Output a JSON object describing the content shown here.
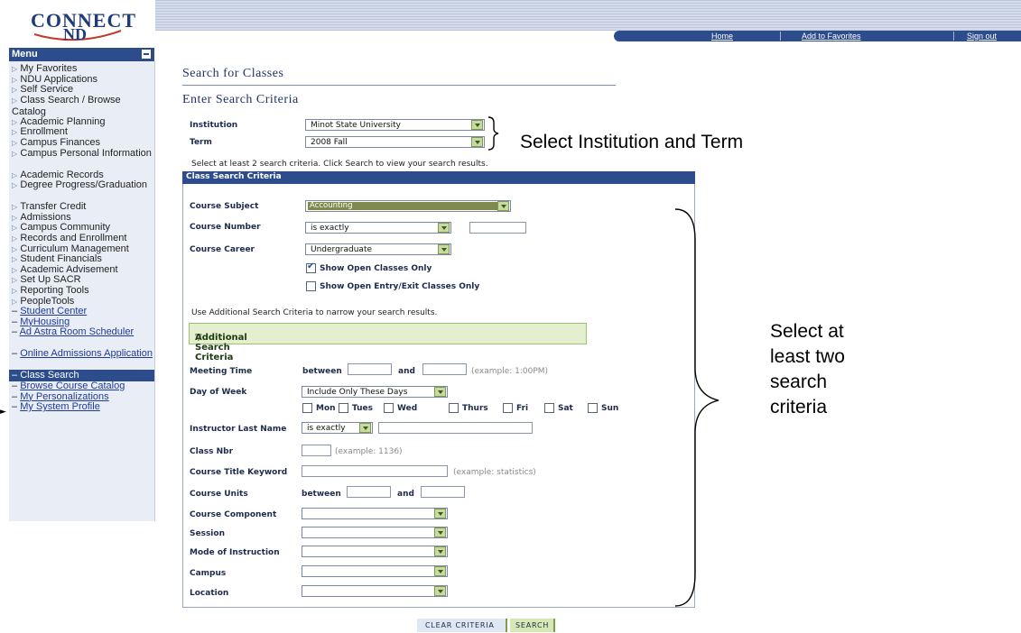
{
  "header": {
    "logo_line1": "CONNECT",
    "logo_line2": "ND",
    "nav": {
      "home": "Home",
      "favorites": "Add to Favorites",
      "signout": "Sign out"
    }
  },
  "menu": {
    "title": "Menu",
    "items": [
      {
        "label": "My Favorites",
        "kind": "folder"
      },
      {
        "label": "NDU Applications",
        "kind": "folder"
      },
      {
        "label": "Self Service",
        "kind": "folder"
      },
      {
        "label": "Class Search / Browse Catalog",
        "kind": "folder"
      },
      {
        "label": "Academic Planning",
        "kind": "folder"
      },
      {
        "label": "Enrollment",
        "kind": "folder"
      },
      {
        "label": "Campus Finances",
        "kind": "folder"
      },
      {
        "label": "Campus Personal Information",
        "kind": "folder"
      },
      {
        "label": "Academic Records",
        "kind": "folder"
      },
      {
        "label": "Degree Progress/Graduation",
        "kind": "folder"
      },
      {
        "label": "Transfer Credit",
        "kind": "folder"
      },
      {
        "label": "Admissions",
        "kind": "folder"
      },
      {
        "label": "Campus Community",
        "kind": "folder"
      },
      {
        "label": "Records and Enrollment",
        "kind": "folder"
      },
      {
        "label": "Curriculum Management",
        "kind": "folder"
      },
      {
        "label": "Student Financials",
        "kind": "folder"
      },
      {
        "label": "Academic Advisement",
        "kind": "folder"
      },
      {
        "label": "Set Up SACR",
        "kind": "folder"
      },
      {
        "label": "Reporting Tools",
        "kind": "folder"
      },
      {
        "label": "PeopleTools",
        "kind": "folder"
      },
      {
        "label": "Student Center",
        "kind": "link"
      },
      {
        "label": "MyHousing",
        "kind": "link"
      },
      {
        "label": "Ad Astra Room Scheduler",
        "kind": "link"
      },
      {
        "label": "Online Admissions Application",
        "kind": "link"
      },
      {
        "label": "Class Search",
        "kind": "selected"
      },
      {
        "label": "Browse Course Catalog",
        "kind": "link"
      },
      {
        "label": "My Personalizations",
        "kind": "link"
      },
      {
        "label": "My System Profile",
        "kind": "link"
      }
    ]
  },
  "page": {
    "title": "Search for Classes",
    "subtitle": "Enter Search Criteria",
    "institution_label": "Institution",
    "institution_value": "Minot State University",
    "term_label": "Term",
    "term_value": "2008 Fall",
    "instruction": "Select at least 2 search criteria. Click Search to view your search results."
  },
  "criteria": {
    "header": "Class Search Criteria",
    "subject_label": "Course Subject",
    "subject_value": "Accounting",
    "number_label": "Course Number",
    "number_op": "is exactly",
    "career_label": "Course Career",
    "career_value": "Undergraduate",
    "open_only": "Show Open Classes Only",
    "open_entry": "Show Open Entry/Exit Classes Only",
    "additional_hint": "Use Additional Search Criteria to narrow your search results.",
    "additional_toggle": "Additional Search Criteria",
    "meeting_label": "Meeting Time",
    "between": "between",
    "and": "and",
    "meeting_example": "(example: 1:00PM)",
    "dow_label": "Day of Week",
    "dow_value": "Include Only These Days",
    "days": [
      "Mon",
      "Tues",
      "Wed",
      "Thurs",
      "Fri",
      "Sat",
      "Sun"
    ],
    "instructor_label": "Instructor Last Name",
    "instructor_op": "is exactly",
    "classnbr_label": "Class Nbr",
    "classnbr_example": "(example: 1136)",
    "keyword_label": "Course Title Keyword",
    "keyword_example": "(example: statistics)",
    "units_label": "Course Units",
    "component_label": "Course Component",
    "session_label": "Session",
    "mode_label": "Mode of Instruction",
    "campus_label": "Campus",
    "location_label": "Location"
  },
  "buttons": {
    "clear": "CLEAR CRITERIA",
    "search": "SEARCH"
  },
  "annotations": {
    "inst_term": "Select Institution and Term",
    "criteria_note": [
      "Select at",
      "least two",
      "search",
      "criteria"
    ]
  }
}
